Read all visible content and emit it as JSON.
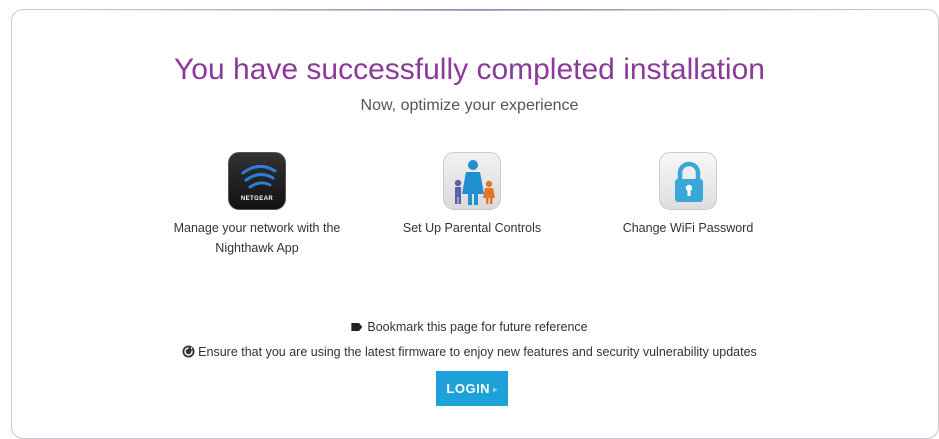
{
  "main": {
    "title": "You have successfully completed installation",
    "subtitle": "Now, optimize your experience"
  },
  "options": [
    {
      "label_line1": "Manage your network with the",
      "label_line2": "Nighthawk App",
      "icon": "netgear-app-icon",
      "brand": "NETGEAR"
    },
    {
      "label": "Set Up Parental Controls",
      "icon": "parental-controls-icon"
    },
    {
      "label": "Change WiFi Password",
      "icon": "lock-icon"
    }
  ],
  "notes": {
    "bookmark": "Bookmark this page for future reference",
    "firmware": "Ensure that you are using the latest firmware to enjoy new features and security vulnerability updates"
  },
  "login": {
    "label": "LOGIN",
    "arrow": "▸"
  },
  "colors": {
    "title": "#8b3a9a",
    "button": "#1da1d8",
    "lock": "#3aa7d9"
  }
}
